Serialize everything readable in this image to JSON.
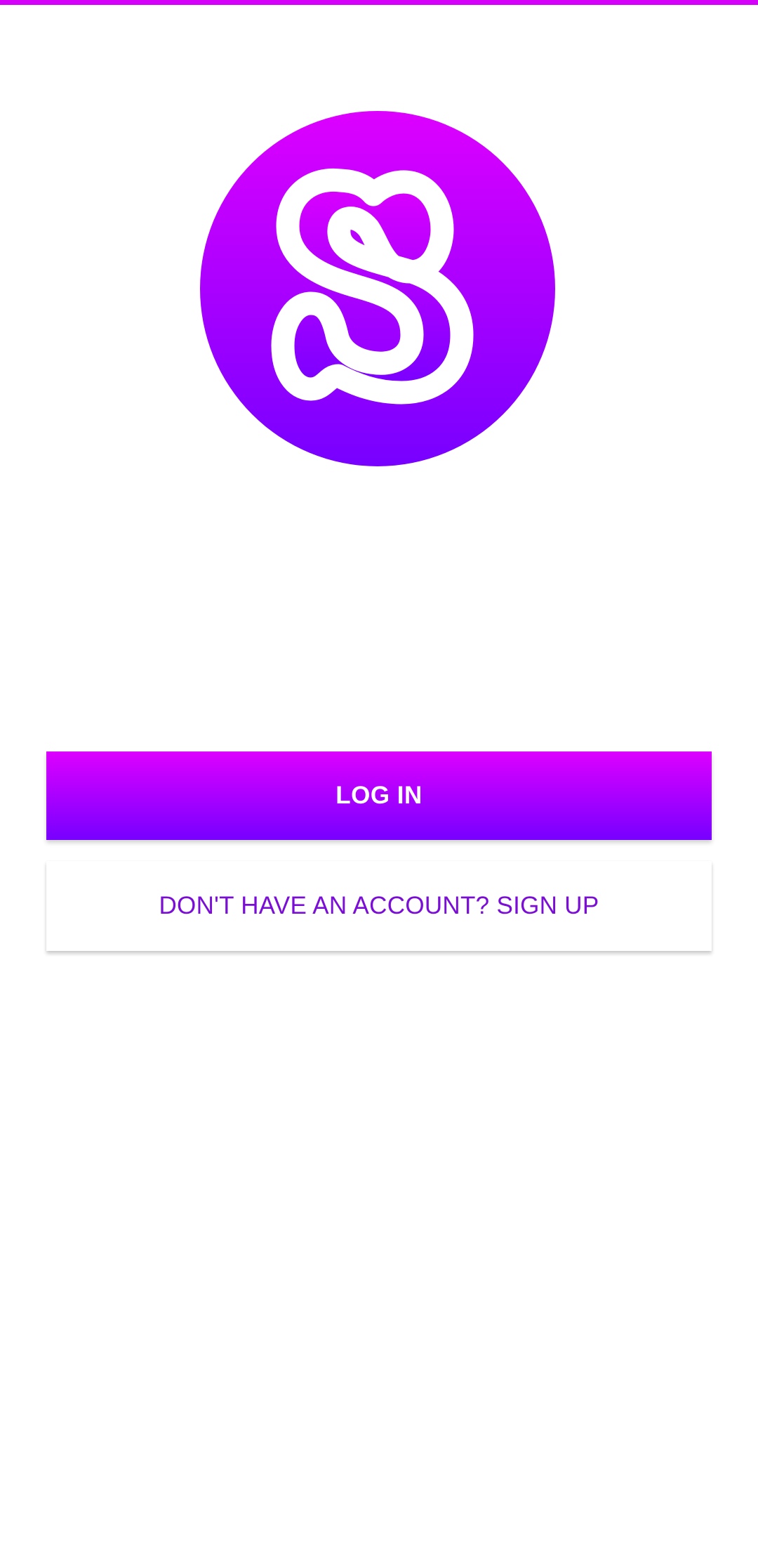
{
  "colors": {
    "gradient_top": "#DD00FF",
    "gradient_bottom": "#7700FF",
    "top_bar": "#D500F9",
    "signup_text": "#7B0ED6",
    "background": "#FFFFFF",
    "logo_letter": "#FFFFFF"
  },
  "logo": {
    "icon": "app-logo-s-icon"
  },
  "actions": {
    "login_label": "LOG IN",
    "signup_label": "DON'T HAVE AN ACCOUNT? SIGN UP"
  }
}
